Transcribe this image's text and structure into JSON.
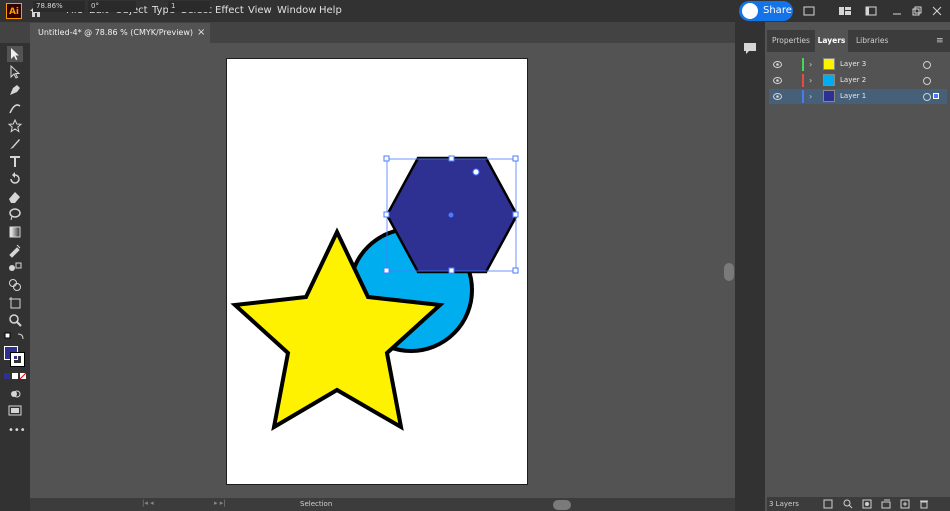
{
  "app": {
    "logo_text": "Ai",
    "accent": "#ff9a00"
  },
  "menu": {
    "items": [
      "File",
      "Edit",
      "Object",
      "Type",
      "Select",
      "Effect",
      "View",
      "Window",
      "Help"
    ]
  },
  "share": {
    "label": "Share",
    "color": "#1473e6"
  },
  "document_tab": {
    "title": "Untitled-4* @ 78.86 % (CMYK/Preview)",
    "close": "×"
  },
  "tools": [
    "selection-tool-icon",
    "direct-selection-tool-icon",
    "pen-tool-icon",
    "curvature-tool-icon",
    "star-tool-icon",
    "paintbrush-tool-icon",
    "type-tool-icon",
    "rotate-tool-icon",
    "eraser-tool-icon",
    "lasso-tool-icon",
    "gradient-tool-icon",
    "eyedropper-tool-icon",
    "blend-tool-icon",
    "shape-builder-tool-icon",
    "artboard-tool-icon",
    "zoom-tool-icon"
  ],
  "colors": {
    "fill": "#2e3192",
    "stroke": "#ffffff"
  },
  "artwork": {
    "star_fill": "#fff200",
    "circle_fill": "#00aeef",
    "hexagon_fill": "#2e3192",
    "outline": "#000000",
    "selection_color": "#4a7bff"
  },
  "status": {
    "zoom": "78.86%",
    "rotation": "0°",
    "artboard": "1",
    "tool": "Selection"
  },
  "panel": {
    "tabs": [
      "Properties",
      "Layers",
      "Libraries"
    ],
    "active_tab": "Layers",
    "layers": [
      {
        "name": "Layer 3",
        "color": "#4bd25a",
        "thumb": "#fff200",
        "selected": false
      },
      {
        "name": "Layer 2",
        "color": "#e64b4b",
        "thumb": "#00aeef",
        "selected": false
      },
      {
        "name": "Layer 1",
        "color": "#4b7be6",
        "thumb": "#2e3192",
        "selected": true
      }
    ],
    "footer_count": "3 Layers"
  }
}
